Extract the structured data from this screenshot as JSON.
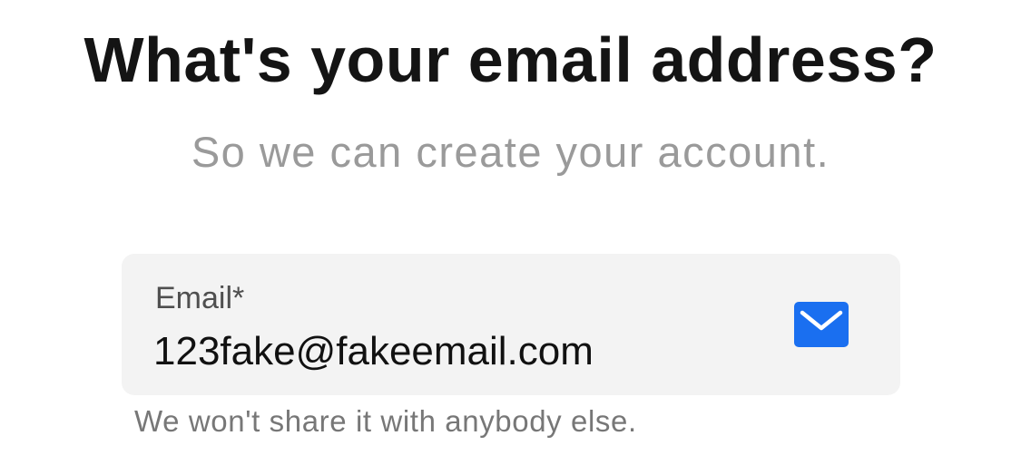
{
  "heading": {
    "title": "What's your email address?",
    "subtitle": "So we can create your account."
  },
  "email_field": {
    "label": "Email*",
    "value": "123fake@fakeemail.com",
    "icon": "mail-icon",
    "helper_text": "We won't share it with anybody else."
  },
  "colors": {
    "accent": "#1a6ff0",
    "field_background": "#f3f3f3",
    "title": "#141414",
    "subtitle": "#9a9a9a",
    "helper": "#777777"
  }
}
